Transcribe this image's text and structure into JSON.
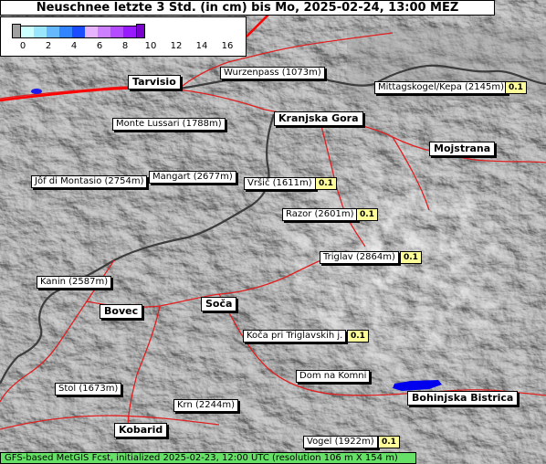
{
  "title": "Neuschnee letzte 3 Std. (in cm) bis Mo, 2025-02-24, 13:00 MEZ",
  "legend": {
    "ticks": [
      "0",
      "2",
      "4",
      "6",
      "8",
      "10",
      "12",
      "14",
      "16"
    ],
    "colors": [
      "#ccffff",
      "#9ae6ff",
      "#66b8ff",
      "#3385ff",
      "#1b4cff",
      "#e6b3ff",
      "#cc80ff",
      "#b34dff",
      "#9a1aff"
    ],
    "low_color": "#a0a0a0",
    "high_color": "#7a00cc"
  },
  "places": [
    {
      "id": "tarvisio",
      "name": "Tarvisio",
      "kind": "town"
    },
    {
      "id": "wurzenpass",
      "name": "Wurzenpass (1073m)",
      "kind": "station"
    },
    {
      "id": "mittagskogel",
      "name": "Mittagskogel/Kepa (2145m)",
      "kind": "station",
      "value": "0.1"
    },
    {
      "id": "monte-lussari",
      "name": "Monte Lussari (1788m)",
      "kind": "station"
    },
    {
      "id": "kranjska-gora",
      "name": "Kranjska Gora",
      "kind": "town"
    },
    {
      "id": "mojstrana",
      "name": "Mojstrana",
      "kind": "town"
    },
    {
      "id": "jof-di-montasio",
      "name": "Jôf di Montasio (2754m)",
      "kind": "station"
    },
    {
      "id": "mangart",
      "name": "Mangart (2677m)",
      "kind": "station"
    },
    {
      "id": "vrsic",
      "name": "Vršič (1611m)",
      "kind": "station",
      "value": "0.1"
    },
    {
      "id": "razor",
      "name": "Razor (2601m)",
      "kind": "station",
      "value": "0.1"
    },
    {
      "id": "triglav",
      "name": "Triglav (2864m)",
      "kind": "station",
      "value": "0.1"
    },
    {
      "id": "kanin",
      "name": "Kanin (2587m)",
      "kind": "station"
    },
    {
      "id": "bovec",
      "name": "Bovec",
      "kind": "town"
    },
    {
      "id": "soca",
      "name": "Soča",
      "kind": "town"
    },
    {
      "id": "koca",
      "name": "Koča pri Triglavskih j.",
      "kind": "station",
      "value": "0.1"
    },
    {
      "id": "dom-na-komni",
      "name": "Dom na Komni",
      "kind": "station"
    },
    {
      "id": "stol",
      "name": "Stol (1673m)",
      "kind": "station"
    },
    {
      "id": "bohinjska-bistrica",
      "name": "Bohinjska Bistrica",
      "kind": "town"
    },
    {
      "id": "krn",
      "name": "Krn (2244m)",
      "kind": "station"
    },
    {
      "id": "kobarid",
      "name": "Kobarid",
      "kind": "town"
    },
    {
      "id": "vogel",
      "name": "Vogel (1922m)",
      "kind": "station",
      "value": "0.1"
    }
  ],
  "footer": "GFS-based MetGIS Fcst, initialized 2025-02-23, 12:00 UTC  (resolution 106 m X 154 m)"
}
